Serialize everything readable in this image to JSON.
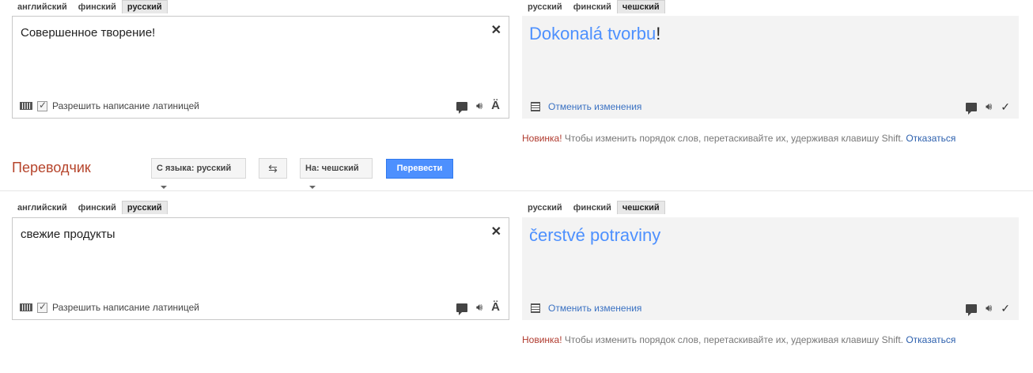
{
  "top": {
    "src_tabs": [
      "английский",
      "финский",
      "русский"
    ],
    "src_active": 2,
    "tgt_tabs": [
      "русский",
      "финский",
      "чешский"
    ],
    "tgt_active": 2,
    "source_text": "Совершенное творение!",
    "latin_label": "Разрешить написание латиницей",
    "result_main": "Dokonalá tvorbu",
    "result_punct": "!",
    "undo_label": "Отменить изменения",
    "notice_new": "Новинка!",
    "notice_text": " Чтобы изменить порядок слов, перетаскивайте их, удерживая клавишу Shift. ",
    "notice_dismiss": "Отказаться"
  },
  "toolbar": {
    "title": "Переводчик",
    "from_label": "С языка: русский",
    "to_label": "На: чешский",
    "translate_label": "Перевести"
  },
  "bottom": {
    "src_tabs": [
      "английский",
      "финский",
      "русский"
    ],
    "src_active": 2,
    "tgt_tabs": [
      "русский",
      "финский",
      "чешский"
    ],
    "tgt_active": 2,
    "source_text": "свежие продукты",
    "latin_label": "Разрешить написание латиницей",
    "result_main": "čerstvé potraviny",
    "result_punct": "",
    "undo_label": "Отменить изменения",
    "notice_new": "Новинка!",
    "notice_text": " Чтобы изменить порядок слов, перетаскивайте их, удерживая клавишу Shift. ",
    "notice_dismiss": "Отказаться"
  },
  "icons": {
    "clear": "close-icon",
    "keyboard": "keyboard-icon",
    "checkbox": "checkbox-icon",
    "comment": "comment-icon",
    "speaker": "speaker-icon",
    "umlaut": "umlaut-icon",
    "document": "document-icon",
    "check": "checkmark-icon",
    "swap": "swap-icon"
  },
  "colors": {
    "accent": "#4d90fe",
    "title": "#b6452c",
    "new_badge": "#b03a2e",
    "result_bg": "#f3f3f3"
  }
}
